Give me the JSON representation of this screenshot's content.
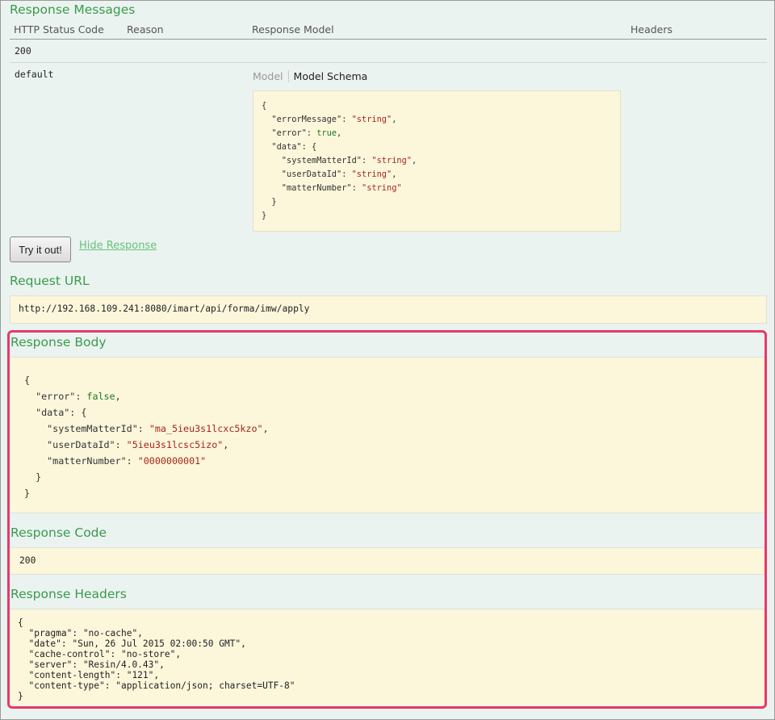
{
  "response_messages": {
    "title": "Response Messages",
    "columns": [
      "HTTP Status Code",
      "Reason",
      "Response Model",
      "Headers"
    ],
    "rows": [
      {
        "code": "200"
      },
      {
        "code": "default"
      }
    ],
    "model_tabs": {
      "model": "Model",
      "schema": "Model Schema"
    },
    "schema_lines": [
      "{",
      "  \"errorMessage\": \"string\",",
      "  \"error\": true,",
      "  \"data\": {",
      "    \"systemMatterId\": \"string\",",
      "    \"userDataId\": \"string\",",
      "    \"matterNumber\": \"string\"",
      "  }",
      "}"
    ]
  },
  "actions": {
    "try_label": "Try it out!",
    "hide_label": "Hide Response"
  },
  "request_url": {
    "title": "Request URL",
    "value": "http://192.168.109.241:8080/imart/api/forma/imw/apply"
  },
  "response_body": {
    "title": "Response Body",
    "lines": [
      "{",
      "  \"error\": false,",
      "  \"data\": {",
      "    \"systemMatterId\": \"ma_5ieu3s1lcxc5kzo\",",
      "    \"userDataId\": \"5ieu3s1lcsc5izo\",",
      "    \"matterNumber\": \"0000000001\"",
      "  }",
      "}"
    ]
  },
  "response_code": {
    "title": "Response Code",
    "value": "200"
  },
  "response_headers": {
    "title": "Response Headers",
    "lines": [
      "{",
      "  \"pragma\": \"no-cache\",",
      "  \"date\": \"Sun, 26 Jul 2015 02:00:50 GMT\",",
      "  \"cache-control\": \"no-store\",",
      "  \"server\": \"Resin/4.0.43\",",
      "  \"content-length\": \"121\",",
      "  \"content-type\": \"application/json; charset=UTF-8\"",
      "}"
    ]
  },
  "colors": {
    "accent": "#3a9b4a",
    "highlight": "#e8386a",
    "code_bg": "#fcf6db"
  }
}
